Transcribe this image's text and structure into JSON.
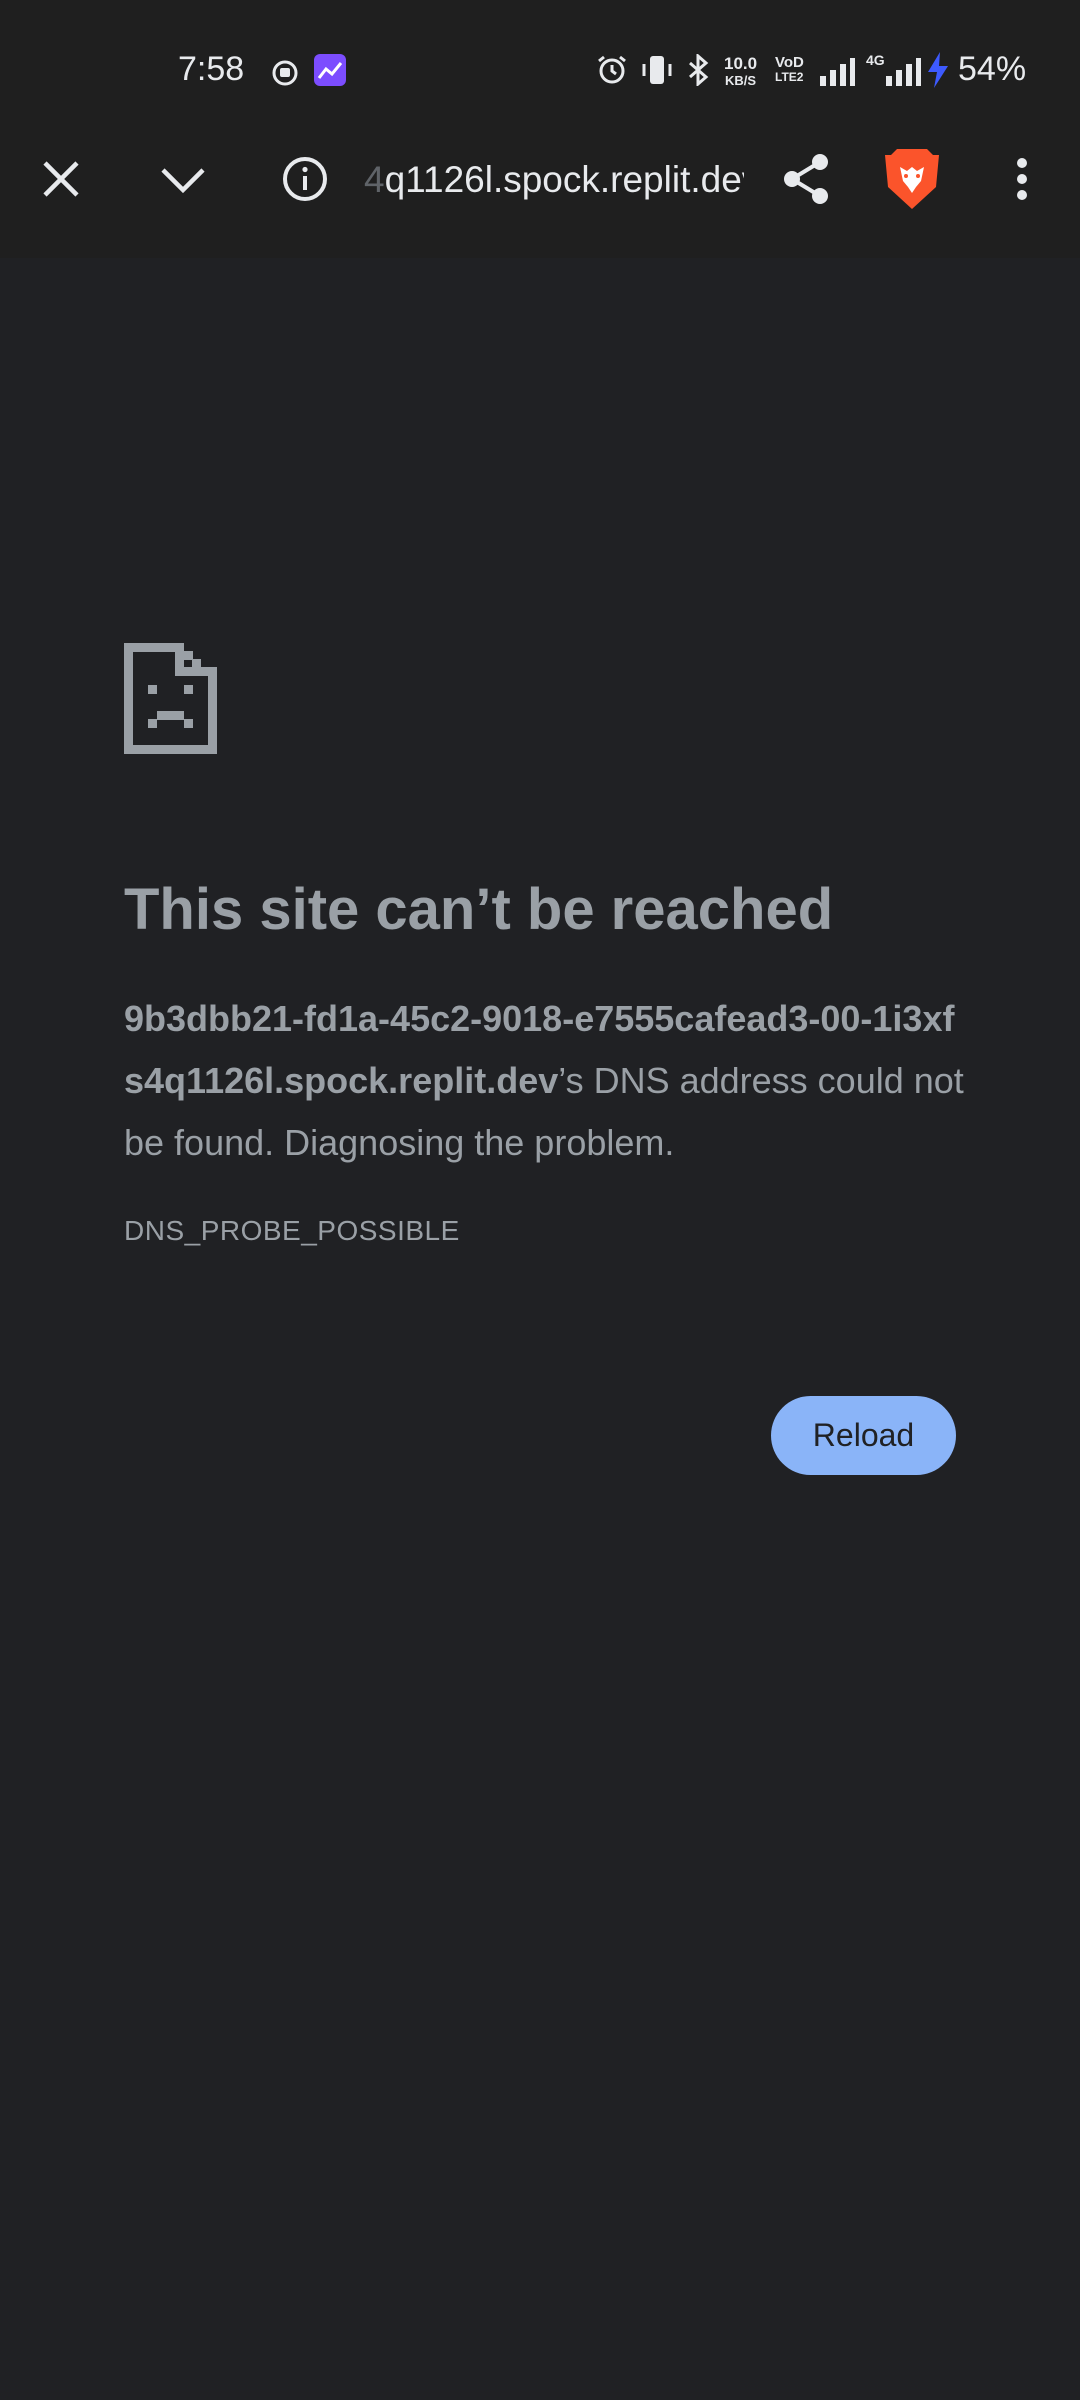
{
  "status_bar": {
    "time": "7:58",
    "net_speed_value": "10.0",
    "net_speed_unit": "KB/S",
    "volte_top": "VoD",
    "volte_bottom": "LTE2",
    "network_type": "4G",
    "battery": "54%",
    "icons": [
      "notification-icon",
      "gallery-app-icon",
      "alarm-icon",
      "vibrate-icon",
      "bluetooth-icon",
      "signal-icon",
      "signal-4g-icon",
      "charging-icon"
    ]
  },
  "toolbar": {
    "url_faded": "4",
    "url_main": "q1126l.spock.replit.dev",
    "icons": [
      "close-icon",
      "chevron-down-icon",
      "info-icon",
      "share-icon",
      "brave-lion-icon",
      "more-vert-icon"
    ]
  },
  "error": {
    "title": "This site can’t be reached",
    "host": "9b3dbb21-fd1a-45c2-9018-e7555cafead3-00-1i3xfs4q1126l.spock.replit.dev",
    "message": "’s DNS address could not be found. Diagnosing the problem.",
    "code": "DNS_PROBE_POSSIBLE",
    "reload_label": "Reload"
  },
  "colors": {
    "background": "#202124",
    "toolbar": "#1f1f1f",
    "text_secondary": "#9aa0a6",
    "reload_button": "#8ab4f8",
    "brave_orange": "#fb542b"
  }
}
